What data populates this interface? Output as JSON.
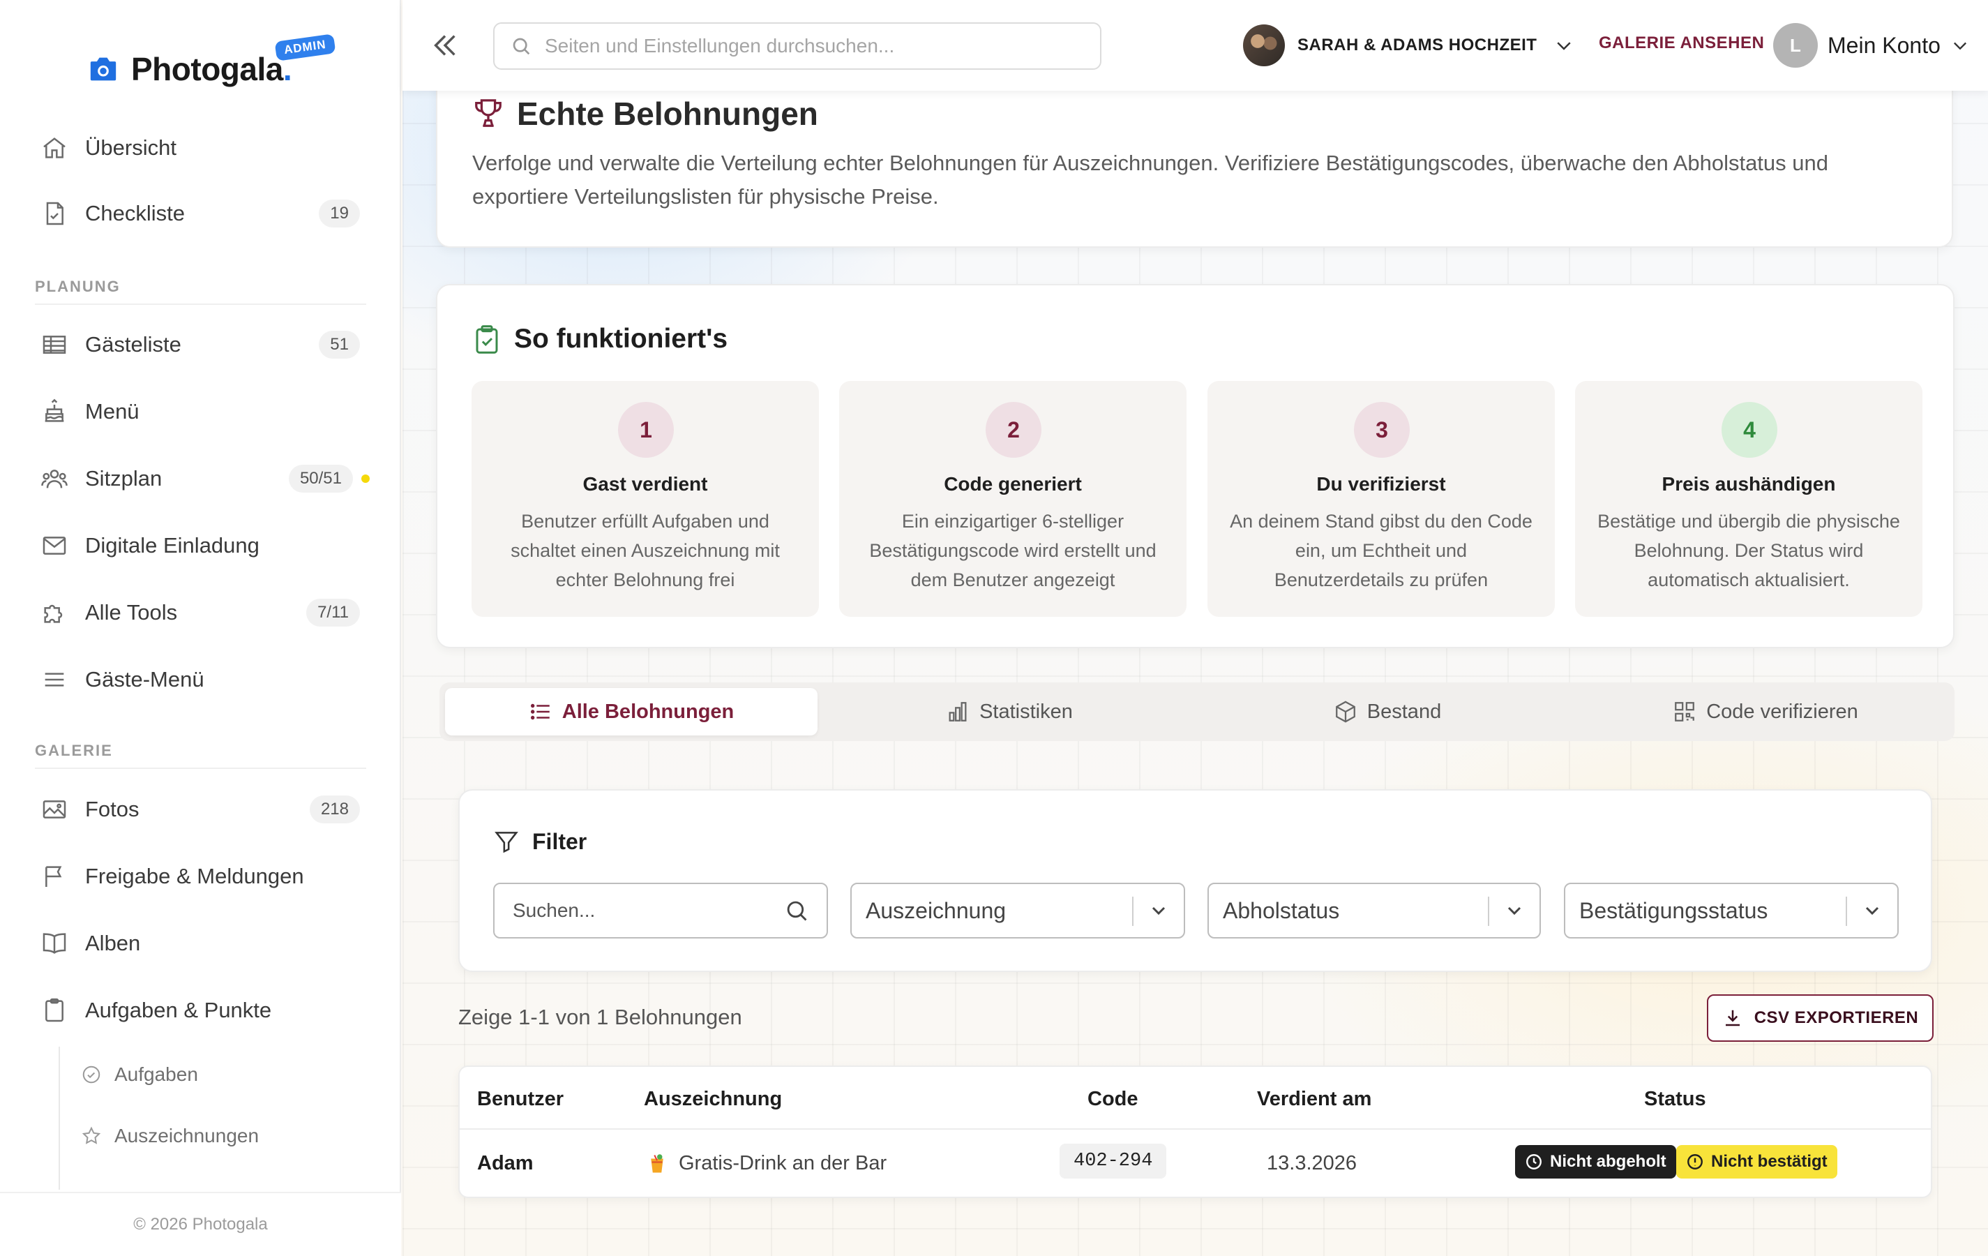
{
  "app": {
    "logo_text": "Photogala",
    "logo_dot": ".",
    "admin_badge": "ADMIN",
    "footer": "© 2026 Photogala",
    "brand_color": "#1f6fe0",
    "accent_color": "#7b1f3a"
  },
  "sidebar": {
    "top_items": [
      {
        "label": "Übersicht",
        "icon": "home-icon"
      },
      {
        "label": "Checkliste",
        "icon": "checklist-icon",
        "badge": "19"
      }
    ],
    "sections": [
      {
        "label": "PLANUNG",
        "items": [
          {
            "label": "Gästeliste",
            "icon": "table-icon",
            "badge": "51"
          },
          {
            "label": "Menü",
            "icon": "cake-icon"
          },
          {
            "label": "Sitzplan",
            "icon": "users-icon",
            "badge": "50/51"
          },
          {
            "label": "Digitale Einladung",
            "icon": "mail-icon"
          },
          {
            "label": "Alle Tools",
            "icon": "puzzle-icon",
            "badge": "7/11"
          },
          {
            "label": "Gäste-Menü",
            "icon": "menu-icon"
          }
        ]
      },
      {
        "label": "GALERIE",
        "items": [
          {
            "label": "Fotos",
            "icon": "image-icon",
            "badge": "218"
          },
          {
            "label": "Freigabe & Meldungen",
            "icon": "flag-icon"
          },
          {
            "label": "Alben",
            "icon": "book-icon"
          },
          {
            "label": "Aufgaben & Punkte",
            "icon": "clipboard-icon"
          }
        ]
      }
    ],
    "sub_items": [
      {
        "label": "Aufgaben",
        "icon": "check-circle-icon"
      },
      {
        "label": "Auszeichnungen",
        "icon": "star-icon"
      }
    ]
  },
  "topbar": {
    "search_placeholder": "Seiten und Einstellungen durchsuchen...",
    "event_name": "SARAH & ADAMS HOCHZEIT",
    "gallery_link": "GALERIE ANSEHEN",
    "account_initial": "L",
    "account_label": "Mein Konto"
  },
  "header": {
    "title": "Echte Belohnungen",
    "description": "Verfolge und verwalte die Verteilung echter Belohnungen für Auszeichnungen. Verifiziere Bestätigungscodes, überwache den Abholstatus und exportiere Verteilungslisten für physische Preise."
  },
  "how": {
    "title": "So funktioniert's",
    "steps": [
      {
        "num": "1",
        "title": "Gast verdient",
        "desc": "Benutzer erfüllt Aufgaben und schaltet einen Auszeichnung mit echter Belohnung frei"
      },
      {
        "num": "2",
        "title": "Code generiert",
        "desc": "Ein einzigartiger 6-stelliger Bestätigungscode wird erstellt und dem Benutzer angezeigt"
      },
      {
        "num": "3",
        "title": "Du verifizierst",
        "desc": "An deinem Stand gibst du den Code ein, um Echtheit und Benutzerdetails zu prüfen"
      },
      {
        "num": "4",
        "title": "Preis aushändigen",
        "desc": "Bestätige und übergib die physische Belohnung. Der Status wird automatisch aktualisiert."
      }
    ]
  },
  "tabs": [
    {
      "label": "Alle Belohnungen",
      "icon": "list-icon",
      "active": true
    },
    {
      "label": "Statistiken",
      "icon": "bar-chart-icon",
      "active": false
    },
    {
      "label": "Bestand",
      "icon": "box-icon",
      "active": false
    },
    {
      "label": "Code verifizieren",
      "icon": "qr-code-icon",
      "active": false
    }
  ],
  "filter": {
    "title": "Filter",
    "search_placeholder": "Suchen...",
    "selects": [
      "Auszeichnung",
      "Abholstatus",
      "Bestätigungsstatus"
    ]
  },
  "results": {
    "count_text": "Zeige 1-1 von 1 Belohnungen",
    "export_label": "CSV EXPORTIEREN"
  },
  "table": {
    "columns": [
      "Benutzer",
      "Auszeichnung",
      "Code",
      "Verdient am",
      "Status"
    ],
    "rows": [
      {
        "user": "Adam",
        "award": "Gratis-Drink an der Bar",
        "code": "402-294",
        "earned": "13.3.2026",
        "status_pickup": "Nicht abgeholt",
        "status_confirm": "Nicht bestätigt"
      }
    ]
  }
}
